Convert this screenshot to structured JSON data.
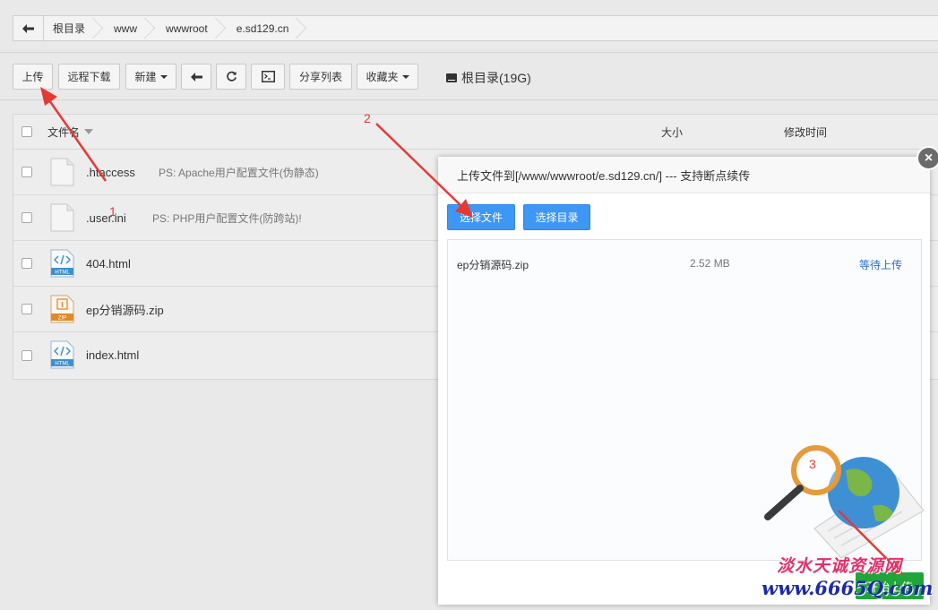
{
  "breadcrumb": {
    "items": [
      "根目录",
      "www",
      "wwwroot",
      "e.sd129.cn"
    ]
  },
  "toolbar": {
    "upload": "上传",
    "remote_download": "远程下载",
    "new": "新建",
    "share_list": "分享列表",
    "favorites": "收藏夹",
    "disk_label": "根目录(19G)"
  },
  "table": {
    "col_name": "文件名",
    "col_size": "大小",
    "col_time": "修改时间",
    "rows": [
      {
        "name": ".htaccess",
        "note": "PS: Apache用户配置文件(伪静态)",
        "icon": "file-icon"
      },
      {
        "name": ".user.ini",
        "note": "PS: PHP用户配置文件(防跨站)!",
        "icon": "file-icon"
      },
      {
        "name": "404.html",
        "note": "",
        "icon": "html-file-icon"
      },
      {
        "name": "ep分销源码.zip",
        "note": "",
        "icon": "zip-file-icon"
      },
      {
        "name": "index.html",
        "note": "",
        "icon": "html-file-icon"
      }
    ]
  },
  "upload_dialog": {
    "title": "上传文件到[/www/wwwroot/e.sd129.cn/] --- 支持断点续传",
    "select_file": "选择文件",
    "select_dir": "选择目录",
    "file": {
      "name": "ep分销源码.zip",
      "size": "2.52 MB",
      "status": "等待上传"
    },
    "start_upload": "开始上传"
  },
  "annotations": {
    "step1": "1",
    "step2": "2",
    "step3": "3"
  },
  "watermark": {
    "line1": "淡水天诚资源网",
    "line2": "www.6665Q.com"
  },
  "colors": {
    "primary_button": "#3e96f5",
    "start_button": "#20a53a",
    "annotation": "#e53935"
  }
}
